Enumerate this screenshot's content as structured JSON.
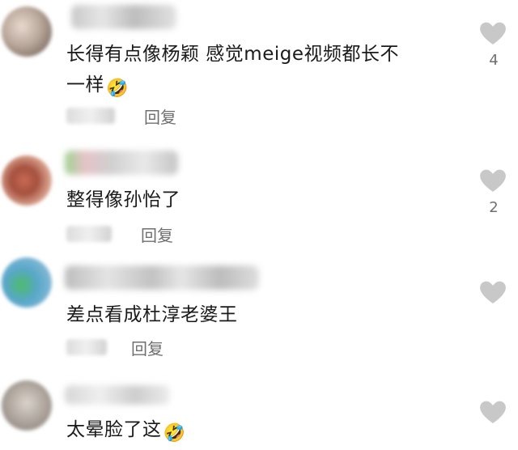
{
  "comments": [
    {
      "author": "",
      "text": "长得有点像杨颖 感觉meige视频都长不",
      "text_line2": "一样",
      "emoji": "🤣",
      "time": "二前",
      "reply_label": "回复",
      "likes": "4"
    },
    {
      "author": "",
      "text": "整得像孙怡了",
      "time": "",
      "reply_label": "回复",
      "likes": "2"
    },
    {
      "author": "",
      "text": "差点看成杜淳老婆王",
      "time": "5",
      "reply_label": "回复",
      "likes": ""
    },
    {
      "author": "",
      "text": "太晕脸了这",
      "emoji": "🤣",
      "time": "",
      "reply_label": "",
      "likes": ""
    }
  ],
  "colors": {
    "text": "#1a1a1a",
    "meta": "#6f6f6f",
    "heart": "#c8c8c8"
  },
  "icons": {
    "like": "heart-icon",
    "emoji": "rolling-on-floor-laughing-emoji"
  }
}
